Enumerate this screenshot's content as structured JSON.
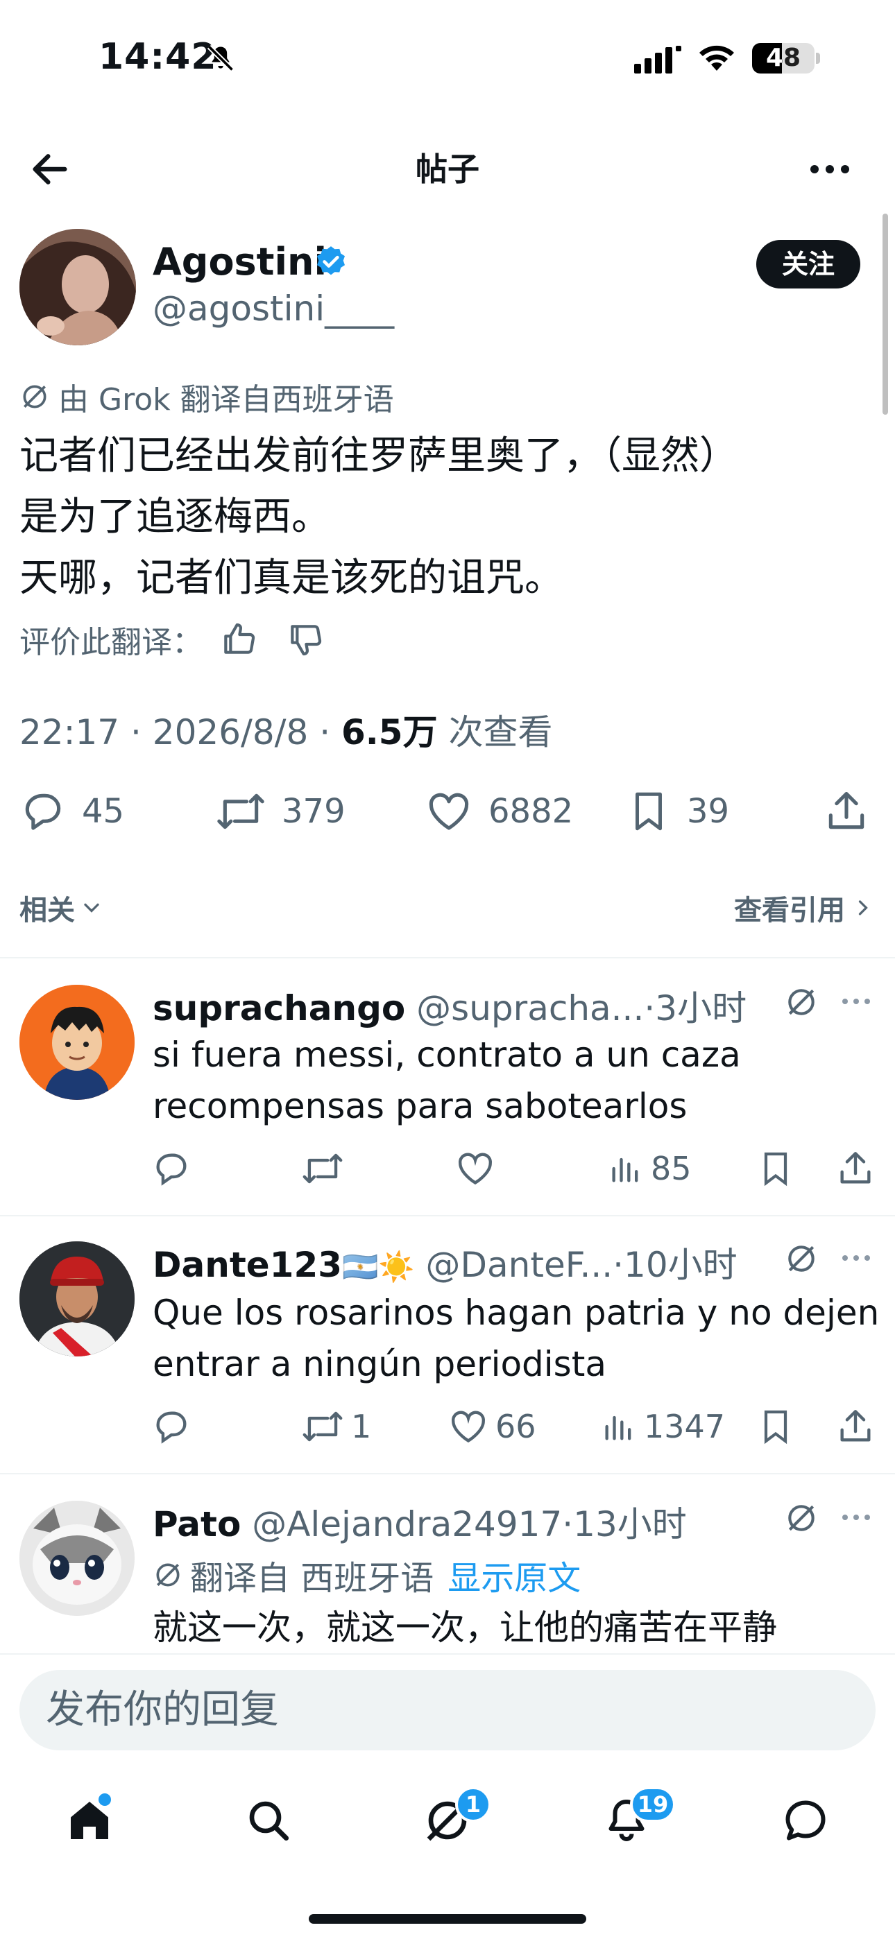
{
  "status_bar": {
    "time": "14:42",
    "battery": "48"
  },
  "header": {
    "title": "帖子",
    "follow_label": "关注"
  },
  "post": {
    "author_name": "Agostini",
    "author_handle": "@agostini____",
    "translation_note": "由 Grok 翻译自西班牙语",
    "text": "记者们已经出发前往罗萨里奥了，（显然）\n是为了追逐梅西。\n天哪，记者们真是该死的诅咒。",
    "rate_label": "评价此翻译：",
    "time": "22:17 · 2026/8/8 · ",
    "views": "6.5万",
    "views_label": " 次查看",
    "replies": "45",
    "reposts": "379",
    "likes": "6882",
    "bookmarks": "39"
  },
  "related": {
    "label": "相关",
    "quotes_label": "查看引用"
  },
  "replies": [
    {
      "name": "suprachango",
      "handle": "@supracha...",
      "time": "·3小时",
      "text": "si fuera messi, contrato a un caza recompensas para sabotearlos",
      "reply_count": "",
      "repost_count": "",
      "like_count": "",
      "views": "85"
    },
    {
      "name": "Dante123",
      "flag_sun": "🇦🇷☀️",
      "handle": "@DanteF...",
      "time": "·10小时",
      "text": "Que los rosarinos hagan patria y no dejen entrar a ningún periodista",
      "reply_count": "",
      "repost_count": "1",
      "like_count": "66",
      "views": "1347"
    },
    {
      "name": "Pato",
      "handle": "@Alejandra24917",
      "time": "·13小时",
      "translated_from": "翻译自 西班牙语",
      "show_original": "显示原文",
      "text": "就这一次，就这一次，让他的痛苦在平静"
    }
  ],
  "composer": {
    "placeholder": "发布你的回复"
  },
  "tabbar": {
    "messages_badge": "1",
    "notifications_badge": "19"
  },
  "colors": {
    "accent": "#1d9bf0",
    "text": "#0f1419",
    "secondary": "#536471"
  }
}
